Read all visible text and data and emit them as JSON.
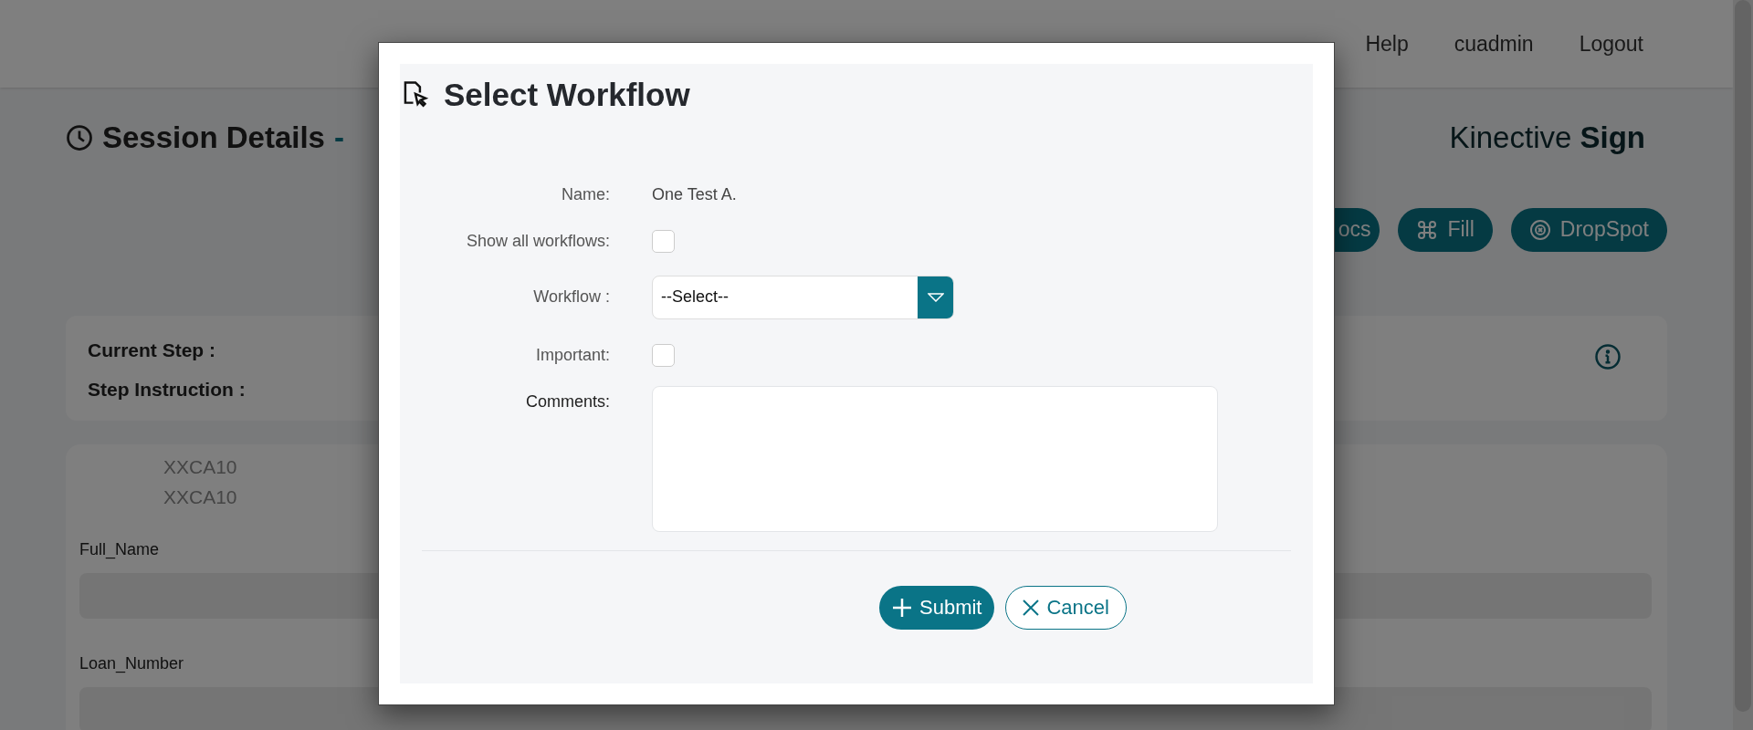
{
  "nav": [
    {
      "label": "Help"
    },
    {
      "label": "cuadmin"
    },
    {
      "label": "Logout"
    }
  ],
  "page_title": {
    "text": "Session Details",
    "separator": "-"
  },
  "brand": "Kinective **Sign**",
  "action_buttons": [
    {
      "label": "ocs",
      "kind": "docs"
    },
    {
      "label": "Fill",
      "kind": "fill"
    },
    {
      "label": "DropSpot",
      "kind": "dropspot"
    }
  ],
  "step_card": {
    "labels": [
      "Current Step :",
      "Step Instruction :"
    ]
  },
  "document_card": {
    "codes": [
      "XXCA10",
      "XXCA10"
    ],
    "fields": [
      {
        "label": "Full_Name"
      },
      {
        "label": "Loan_Number"
      }
    ]
  },
  "modal": {
    "title": "Select Workflow",
    "fields": [
      {
        "kind": "text",
        "label": "Name:",
        "value": "One Test A."
      },
      {
        "kind": "checkbox",
        "label": "Show all workflows:",
        "checked": false
      },
      {
        "kind": "select",
        "label": "Workflow :",
        "value": "--Select--"
      },
      {
        "kind": "checkbox",
        "label": "Important:",
        "checked": false
      },
      {
        "kind": "textarea",
        "label": "Comments:"
      }
    ],
    "buttons": [
      {
        "label": "Submit",
        "kind": "primary"
      },
      {
        "label": "Cancel",
        "kind": "secondary"
      }
    ]
  }
}
